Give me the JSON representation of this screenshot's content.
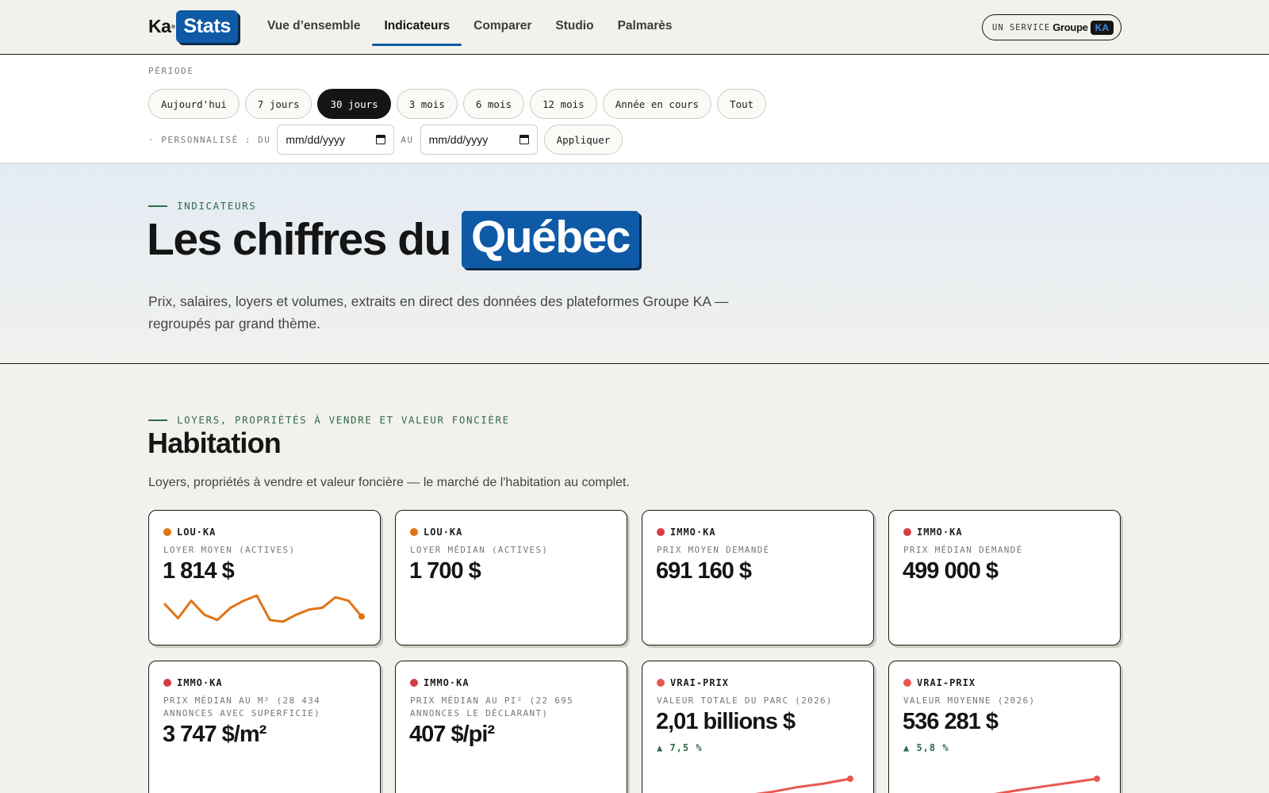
{
  "topbar": {
    "logo": {
      "left": "Ka",
      "right": "Stats"
    },
    "nav": [
      {
        "label": "Vue d’ensemble",
        "active": false
      },
      {
        "label": "Indicateurs",
        "active": true
      },
      {
        "label": "Comparer",
        "active": false
      },
      {
        "label": "Studio",
        "active": false
      },
      {
        "label": "Palmarès",
        "active": false
      }
    ],
    "service": {
      "label": "UN SERVICE",
      "brand": "Groupe",
      "badge": "KA"
    }
  },
  "period": {
    "title": "PÉRIODE",
    "chips": [
      {
        "label": "Aujourd'hui",
        "active": false
      },
      {
        "label": "7 jours",
        "active": false
      },
      {
        "label": "30 jours",
        "active": true
      },
      {
        "label": "3 mois",
        "active": false
      },
      {
        "label": "6 mois",
        "active": false
      },
      {
        "label": "12 mois",
        "active": false
      },
      {
        "label": "Année en cours",
        "active": false
      },
      {
        "label": "Tout",
        "active": false
      }
    ],
    "custom_label": "· PERSONNALISÉ : DU",
    "from_placeholder": "mm/dd/yyyy",
    "to_label": "AU",
    "to_placeholder": "mm/dd/yyyy",
    "apply": "Appliquer"
  },
  "hero": {
    "eyebrow": "INDICATEURS",
    "title": "Les chiffres du",
    "highlight": "Québec",
    "subtitle": "Prix, salaires, loyers et volumes, extraits en direct des données des plateformes Groupe KA — regroupés par grand thème."
  },
  "section": {
    "eyebrow": "LOYERS, PROPRIÉTÉS À VENDRE ET VALEUR FONCIÈRE",
    "title": "Habitation",
    "description": "Loyers, propriétés à vendre et valeur foncière — le marché de l'habitation au complet."
  },
  "colors": {
    "accent_blue": "#0e5aa7",
    "louka": "#e07416",
    "immoka": "#d63b45",
    "vraiprix": "#e8574f",
    "delta_up": "#2f6b4a"
  },
  "cards": [
    {
      "source": "LOU·KA",
      "label": "LOYER MOYEN (ACTIVES)",
      "value": "1 814 $",
      "dot": "#e07416",
      "sparkline": [
        16,
        8,
        18,
        10,
        7,
        14,
        18,
        21,
        7,
        6,
        10,
        13,
        14,
        20,
        18,
        9
      ]
    },
    {
      "source": "LOU·KA",
      "label": "LOYER MÉDIAN (ACTIVES)",
      "value": "1 700 $",
      "dot": "#e07416"
    },
    {
      "source": "IMMO·KA",
      "label": "PRIX MOYEN DEMANDÉ",
      "value": "691 160 $",
      "dot": "#d63b45"
    },
    {
      "source": "IMMO·KA",
      "label": "PRIX MÉDIAN DEMANDÉ",
      "value": "499 000 $",
      "dot": "#d63b45"
    },
    {
      "source": "IMMO·KA",
      "label": "PRIX MÉDIAN AU M² (28 434 ANNONCES AVEC SUPERFICIE)",
      "value": "3 747 $/m²",
      "dot": "#d63b45"
    },
    {
      "source": "IMMO·KA",
      "label": "PRIX MÉDIAN AU PI² (22 695 ANNONCES LE DÉCLARANT)",
      "value": "407 $/pi²",
      "dot": "#d63b45"
    },
    {
      "source": "VRAI-PRIX",
      "label": "VALEUR TOTALE DU PARC (2026)",
      "value": "2,01 billions $",
      "delta": "▲ 7,5 %",
      "dot": "#e8574f",
      "sparkline": [
        1.8,
        1.84,
        1.85,
        1.87,
        1.9,
        1.94,
        1.97,
        2.01
      ]
    },
    {
      "source": "VRAI-PRIX",
      "label": "VALEUR MOYENNE (2026)",
      "value": "536 281 $",
      "delta": "▲ 5,8 %",
      "dot": "#e8574f",
      "sparkline": [
        490,
        500,
        503,
        507,
        515,
        522,
        529,
        536
      ]
    }
  ]
}
